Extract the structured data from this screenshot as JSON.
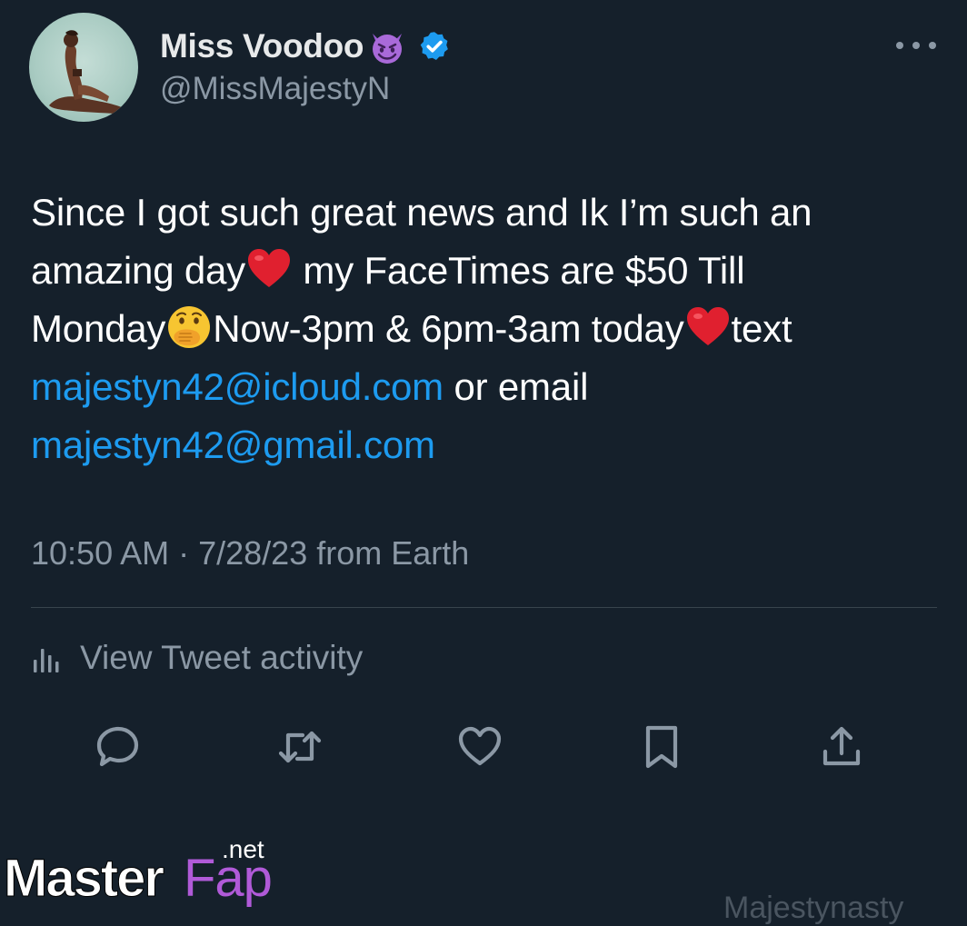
{
  "author": {
    "display_name": "Miss Voodoo",
    "handle": "@MissMajestyN",
    "verified": true
  },
  "icons": {
    "more": "more-dots-icon",
    "verified": "verified-badge-icon",
    "reply": "reply-icon",
    "retweet": "retweet-icon",
    "like": "heart-icon",
    "bookmark": "bookmark-icon",
    "share": "share-icon",
    "activity": "bar-chart-icon"
  },
  "tweet": {
    "line1": "Since I got such great news and Ik I’m such an",
    "line2a": "amazing day",
    "line2b": " my FaceTimes are $50 Till",
    "line3a": "Monday",
    "line3b": "Now-3pm & 6pm-3am today",
    "line3c": "text",
    "email1": "majestyn42@icloud.com",
    "line4b": " or email",
    "email2": "majestyn42@gmail.com"
  },
  "meta": {
    "time": "10:50 AM",
    "separator": " · ",
    "date": "7/28/23",
    "source": " from Earth"
  },
  "activity_label": "View Tweet activity",
  "watermark": {
    "master": "Master",
    "fap": "Fap",
    "tld": ".net",
    "bottom_right": "Majestynasty"
  },
  "colors": {
    "background": "#15202b",
    "link": "#1d9bf0",
    "secondary_text": "#8b98a5",
    "divider": "#38444d"
  }
}
